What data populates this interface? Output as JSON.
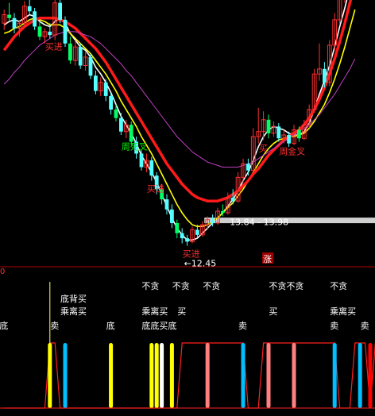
{
  "chart_data": [
    {
      "type": "candlestick",
      "title": "",
      "candles": [
        [
          25.6,
          26.4,
          25.2,
          26.1
        ],
        [
          26.1,
          26.8,
          25.7,
          25.9
        ],
        [
          25.9,
          26.2,
          25.0,
          25.3
        ],
        [
          25.3,
          25.8,
          24.8,
          25.6
        ],
        [
          25.6,
          26.9,
          25.4,
          26.6
        ],
        [
          26.6,
          27.4,
          26.1,
          26.3
        ],
        [
          26.3,
          26.5,
          25.2,
          25.4
        ],
        [
          25.4,
          25.7,
          24.6,
          24.8
        ],
        [
          24.8,
          25.3,
          24.4,
          25.1
        ],
        [
          25.1,
          25.6,
          24.7,
          24.9
        ],
        [
          24.9,
          27.3,
          24.6,
          26.8
        ],
        [
          26.8,
          27.0,
          25.6,
          25.8
        ],
        [
          25.8,
          26.0,
          24.2,
          24.4
        ],
        [
          24.4,
          24.8,
          23.2,
          23.4
        ],
        [
          23.4,
          24.6,
          23.1,
          24.2
        ],
        [
          24.2,
          24.4,
          22.9,
          23.1
        ],
        [
          23.1,
          23.9,
          22.8,
          23.6
        ],
        [
          23.6,
          23.8,
          22.3,
          22.5
        ],
        [
          22.5,
          22.8,
          21.4,
          21.6
        ],
        [
          21.6,
          22.4,
          21.3,
          22.1
        ],
        [
          22.1,
          22.3,
          21.0,
          21.3
        ],
        [
          21.3,
          21.5,
          20.2,
          20.5
        ],
        [
          20.5,
          20.8,
          19.8,
          20.0
        ],
        [
          20.0,
          20.3,
          19.0,
          19.2
        ],
        [
          19.2,
          19.9,
          18.8,
          19.6
        ],
        [
          19.6,
          19.8,
          18.4,
          18.6
        ],
        [
          18.6,
          18.9,
          17.6,
          17.9
        ],
        [
          17.9,
          18.1,
          16.9,
          17.1
        ],
        [
          17.1,
          17.9,
          16.8,
          17.5
        ],
        [
          17.5,
          17.7,
          16.3,
          16.6
        ],
        [
          16.6,
          16.8,
          15.5,
          15.8
        ],
        [
          15.8,
          16.1,
          14.9,
          15.2
        ],
        [
          15.2,
          15.5,
          14.3,
          14.6
        ],
        [
          14.6,
          14.9,
          13.5,
          13.8
        ],
        [
          13.8,
          14.0,
          12.9,
          13.2
        ],
        [
          13.2,
          13.5,
          12.6,
          12.9
        ],
        [
          12.9,
          13.1,
          12.45,
          12.7
        ],
        [
          12.7,
          13.6,
          12.6,
          13.4
        ],
        [
          13.4,
          13.7,
          12.9,
          13.1
        ],
        [
          13.1,
          13.9,
          13.0,
          13.7
        ],
        [
          13.7,
          14.2,
          13.4,
          14.0
        ],
        [
          14.0,
          14.3,
          13.6,
          13.8
        ],
        [
          13.8,
          14.7,
          13.7,
          14.5
        ],
        [
          14.5,
          14.9,
          14.2,
          14.4
        ],
        [
          14.4,
          15.6,
          14.3,
          15.3
        ],
        [
          15.3,
          15.8,
          14.9,
          15.1
        ],
        [
          15.1,
          16.8,
          15.0,
          16.5
        ],
        [
          16.5,
          17.6,
          16.2,
          17.3
        ],
        [
          17.3,
          17.6,
          16.6,
          16.9
        ],
        [
          16.9,
          19.4,
          16.8,
          18.9
        ],
        [
          18.9,
          20.6,
          18.5,
          19.2
        ],
        [
          19.2,
          20.4,
          18.7,
          19.9
        ],
        [
          19.9,
          20.2,
          18.8,
          19.1
        ],
        [
          19.1,
          19.8,
          18.9,
          19.5
        ],
        [
          19.5,
          19.7,
          18.6,
          18.8
        ],
        [
          18.8,
          19.3,
          18.5,
          19.0
        ],
        [
          19.0,
          19.2,
          18.3,
          18.5
        ],
        [
          18.5,
          19.6,
          18.4,
          19.3
        ],
        [
          19.3,
          19.5,
          18.6,
          18.8
        ],
        [
          18.8,
          19.9,
          18.7,
          19.6
        ],
        [
          19.6,
          20.8,
          19.4,
          20.5
        ],
        [
          20.5,
          22.9,
          20.3,
          22.6
        ],
        [
          22.6,
          24.4,
          22.2,
          22.9
        ],
        [
          22.9,
          23.3,
          21.8,
          22.1
        ],
        [
          22.1,
          24.6,
          21.9,
          24.3
        ],
        [
          24.3,
          26.2,
          24.0,
          25.8
        ],
        [
          25.8,
          27.6,
          25.5,
          27.2
        ],
        [
          27.2,
          28.2,
          26.8,
          27.4
        ],
        [
          27.4,
          29.5,
          27.1,
          29.2
        ],
        [
          29.2,
          30.8,
          28.9,
          30.4
        ]
      ],
      "series": [
        {
          "name": "",
          "color": "#ffffff",
          "values": [
            25.5,
            25.7,
            25.8,
            25.7,
            25.9,
            26.1,
            26.0,
            25.7,
            25.5,
            25.4,
            25.7,
            25.9,
            25.6,
            25.0,
            24.6,
            24.2,
            24.0,
            23.6,
            23.0,
            22.6,
            22.1,
            21.5,
            20.8,
            20.1,
            19.6,
            19.1,
            18.5,
            17.8,
            17.3,
            16.8,
            16.2,
            15.5,
            14.8,
            14.1,
            13.5,
            13.1,
            12.8,
            12.8,
            12.9,
            13.2,
            13.5,
            13.8,
            14.1,
            14.4,
            14.8,
            15.2,
            15.7,
            16.3,
            16.8,
            17.5,
            18.3,
            18.9,
            19.3,
            19.5,
            19.4,
            19.3,
            19.1,
            19.0,
            19.0,
            19.2,
            19.7,
            20.5,
            21.4,
            22.2,
            23.1,
            24.2,
            25.4,
            26.5,
            27.7,
            29.0
          ]
        },
        {
          "name": "",
          "color": "#ffff00",
          "values": [
            25.0,
            25.1,
            25.3,
            25.4,
            25.6,
            25.8,
            25.9,
            25.8,
            25.7,
            25.5,
            25.5,
            25.5,
            25.3,
            25.0,
            24.7,
            24.4,
            24.1,
            23.8,
            23.4,
            23.0,
            22.6,
            22.1,
            21.6,
            21.0,
            20.5,
            20.0,
            19.5,
            18.9,
            18.4,
            17.9,
            17.3,
            16.7,
            16.1,
            15.5,
            14.9,
            14.4,
            14.0,
            13.7,
            13.6,
            13.6,
            13.7,
            13.9,
            14.1,
            14.4,
            14.7,
            15.0,
            15.4,
            15.8,
            16.3,
            16.8,
            17.3,
            17.8,
            18.2,
            18.5,
            18.7,
            18.8,
            18.9,
            18.9,
            19.0,
            19.1,
            19.4,
            19.8,
            20.3,
            20.8,
            21.5,
            22.3,
            23.2,
            24.2,
            25.3,
            26.4
          ]
        },
        {
          "name": "",
          "color": "#ff1a1a",
          "values": [
            24.0,
            24.4,
            24.8,
            25.1,
            25.4,
            25.6,
            25.8,
            25.9,
            25.9,
            25.9,
            25.9,
            25.8,
            25.7,
            25.5,
            25.3,
            25.0,
            24.7,
            24.4,
            24.1,
            23.7,
            23.3,
            22.8,
            22.3,
            21.8,
            21.3,
            20.8,
            20.3,
            19.8,
            19.3,
            18.8,
            18.3,
            17.8,
            17.3,
            16.9,
            16.5,
            16.1,
            15.8,
            15.5,
            15.3,
            15.2,
            15.1,
            15.1,
            15.1,
            15.2,
            15.3,
            15.5,
            15.7,
            16.0,
            16.3,
            16.7,
            17.0,
            17.4,
            17.8,
            18.1,
            18.4,
            18.7,
            18.9,
            19.1,
            19.3,
            19.6,
            20.0,
            20.5,
            21.1,
            21.8,
            22.6,
            23.5,
            24.5,
            25.6,
            26.8,
            28.0
          ]
        },
        {
          "name": "",
          "color": "#c040c0",
          "values": [
            22.0,
            22.3,
            22.7,
            23.0,
            23.4,
            23.7,
            24.0,
            24.3,
            24.5,
            24.7,
            24.9,
            25.0,
            25.1,
            25.1,
            25.1,
            25.0,
            24.9,
            24.8,
            24.6,
            24.4,
            24.1,
            23.8,
            23.5,
            23.2,
            22.8,
            22.5,
            22.1,
            21.7,
            21.3,
            20.9,
            20.5,
            20.1,
            19.7,
            19.3,
            18.9,
            18.6,
            18.3,
            18.0,
            17.8,
            17.6,
            17.4,
            17.3,
            17.2,
            17.1,
            17.1,
            17.1,
            17.1,
            17.2,
            17.3,
            17.4,
            17.6,
            17.8,
            18.0,
            18.2,
            18.4,
            18.6,
            18.8,
            19.0,
            19.2,
            19.4,
            19.6,
            19.9,
            20.2,
            20.6,
            21.0,
            21.4,
            21.9,
            22.4,
            22.9,
            23.5
          ]
        }
      ],
      "ylim": [
        11.5,
        26.5
      ],
      "annotations": [
        {
          "index": 9,
          "text": "买进",
          "color": "#ff3030"
        },
        {
          "index": 24,
          "text": "周死叉",
          "color": "#00ff00"
        },
        {
          "index": 29,
          "text": "买进",
          "color": "#ff3030"
        },
        {
          "index": 36,
          "text": "买进",
          "color": "#ff3030"
        },
        {
          "index": 51,
          "text": "买",
          "color": "#ff3030"
        },
        {
          "index": 55,
          "text": "周金叉",
          "color": "#ff3030"
        }
      ],
      "price_labels": [
        {
          "index": 36,
          "text": "←12.45",
          "color": "#ffffff"
        },
        {
          "index": 45,
          "text": "13.84 - 13.98",
          "color": "#ffffff"
        }
      ],
      "zhang_label": "涨",
      "zero_label": "0"
    },
    {
      "type": "bar",
      "title": "",
      "texts": [
        {
          "index": 0,
          "row": "r4",
          "text": "底",
          "color": "#ffffff"
        },
        {
          "index": 10,
          "row": "r4",
          "text": "卖",
          "color": "#ffffff"
        },
        {
          "index": 12,
          "row": "r2",
          "text": "底背买",
          "color": "#ffffff"
        },
        {
          "index": 12,
          "row": "r3",
          "text": "乘离买",
          "color": "#ffffff"
        },
        {
          "index": 21,
          "row": "r4",
          "text": "底",
          "color": "#ffffff"
        },
        {
          "index": 28,
          "row": "r1",
          "text": "不贪",
          "color": "#ffffff"
        },
        {
          "index": 28,
          "row": "r3",
          "text": "乘离买",
          "color": "#ffffff"
        },
        {
          "index": 28,
          "row": "r4",
          "text": "底底买底",
          "color": "#ffffff"
        },
        {
          "index": 34,
          "row": "r1",
          "text": "不贪",
          "color": "#ffffff"
        },
        {
          "index": 35,
          "row": "r3",
          "text": "买",
          "color": "#ffffff"
        },
        {
          "index": 40,
          "row": "r1",
          "text": "不贪",
          "color": "#ffffff"
        },
        {
          "index": 47,
          "row": "r4",
          "text": "卖",
          "color": "#ffffff"
        },
        {
          "index": 53,
          "row": "r1",
          "text": "不贪不贪",
          "color": "#ffffff"
        },
        {
          "index": 53,
          "row": "r3",
          "text": "买",
          "color": "#ffffff"
        },
        {
          "index": 65,
          "row": "r1",
          "text": "不贪",
          "color": "#ffffff"
        },
        {
          "index": 65,
          "row": "r3",
          "text": "乘离买",
          "color": "#ffffff"
        },
        {
          "index": 65,
          "row": "r4",
          "text": "卖",
          "color": "#ffffff"
        },
        {
          "index": 71,
          "row": "r4",
          "text": "卖",
          "color": "#ffffff"
        },
        {
          "index": 76,
          "row": "r4",
          "text": "卖",
          "color": "#ffffff"
        }
      ],
      "bars": [
        {
          "index": 9,
          "color": "#ffff00",
          "value": 1
        },
        {
          "index": 12,
          "color": "#00bfff",
          "value": 1
        },
        {
          "index": 21,
          "color": "#ffff00",
          "value": 1
        },
        {
          "index": 29,
          "color": "#ffff00",
          "value": 1
        },
        {
          "index": 30,
          "color": "#ffff00",
          "value": 1
        },
        {
          "index": 31,
          "color": "#ffffff",
          "value": 1
        },
        {
          "index": 33,
          "color": "#ffff00",
          "value": 1
        },
        {
          "index": 40,
          "color": "#ff8080",
          "value": 1
        },
        {
          "index": 47,
          "color": "#00bfff",
          "value": 1
        },
        {
          "index": 52,
          "color": "#ff8080",
          "value": 1
        },
        {
          "index": 57,
          "color": "#ff8080",
          "value": 1
        },
        {
          "index": 65,
          "color": "#00bfff",
          "value": 1
        },
        {
          "index": 70,
          "color": "#00bfff",
          "value": 1
        },
        {
          "index": 72,
          "color": "#ff0000",
          "value": 1
        },
        {
          "index": 75,
          "color": "#00bfff",
          "value": 1
        }
      ],
      "signal_line": {
        "color": "#ff2020",
        "values": [
          0,
          0,
          0,
          0,
          0,
          0,
          0,
          0,
          0,
          1,
          1,
          0,
          0,
          0,
          0,
          0,
          0,
          0,
          0,
          0,
          0,
          0,
          0,
          0,
          0,
          0,
          0,
          0,
          0,
          0,
          0,
          0,
          0,
          0,
          0,
          1,
          1,
          1,
          1,
          1,
          1,
          1,
          1,
          1,
          1,
          1,
          1,
          1,
          0,
          0,
          0,
          1,
          1,
          1,
          1,
          1,
          1,
          1,
          1,
          1,
          1,
          1,
          1,
          1,
          1,
          1,
          0,
          0,
          0,
          1,
          1,
          1,
          0,
          1,
          1,
          0,
          1
        ]
      }
    }
  ]
}
